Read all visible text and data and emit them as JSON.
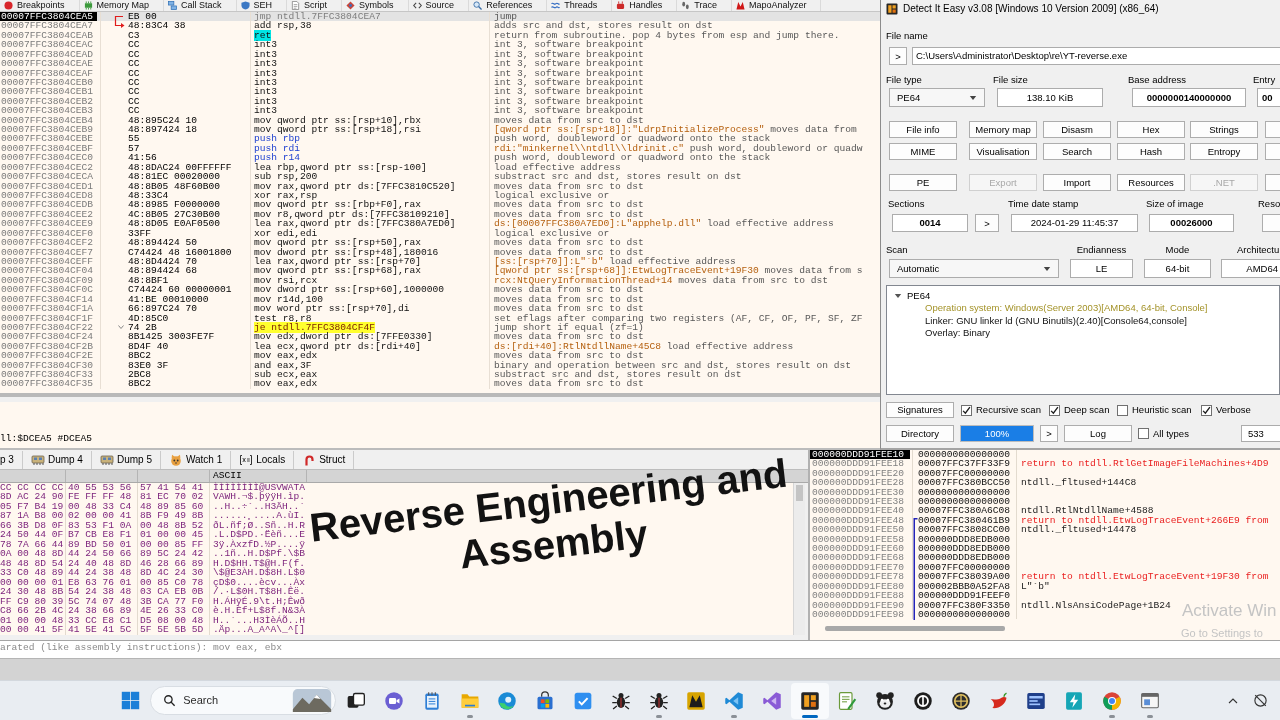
{
  "debugger_tabs": [
    "Breakpoints",
    "Memory Map",
    "Call Stack",
    "SEH",
    "Script",
    "Symbols",
    "Source",
    "References",
    "Threads",
    "Handles",
    "Trace",
    "MapoAnalyzer"
  ],
  "disassembly": {
    "rows": [
      {
        "address": "00007FFC3804CEA5",
        "bytes": "EB 00",
        "instruction": "jmp ntdll.7FFC3804CEA7",
        "comment": "jump",
        "kind": "jump",
        "selected": true
      },
      {
        "address": "00007FFC3804CEA7",
        "bytes": "48:83C4 38",
        "instruction": "add rsp,38",
        "comment": "adds src and dst, stores result on dst",
        "kind": "data",
        "selected": false
      },
      {
        "address": "00007FFC3804CEAB",
        "bytes": "C3",
        "instruction": "ret",
        "comment": "return from subroutine. pop 4 bytes from esp and jump there.",
        "kind": "return",
        "selected": false
      },
      {
        "address": "00007FFC3804CEAC",
        "bytes": "CC",
        "instruction": "int3",
        "comment": "int 3, software breakpoint",
        "kind": "interrupt",
        "selected": false
      },
      {
        "address": "00007FFC3804CEAD",
        "bytes": "CC",
        "instruction": "int3",
        "comment": "int 3, software breakpoint",
        "kind": "interrupt",
        "selected": false
      },
      {
        "address": "00007FFC3804CEAE",
        "bytes": "CC",
        "instruction": "int3",
        "comment": "int 3, software breakpoint",
        "kind": "interrupt",
        "selected": false
      },
      {
        "address": "00007FFC3804CEAF",
        "bytes": "CC",
        "instruction": "int3",
        "comment": "int 3, software breakpoint",
        "kind": "interrupt",
        "selected": false
      },
      {
        "address": "00007FFC3804CEB0",
        "bytes": "CC",
        "instruction": "int3",
        "comment": "int 3, software breakpoint",
        "kind": "interrupt",
        "selected": false
      },
      {
        "address": "00007FFC3804CEB1",
        "bytes": "CC",
        "instruction": "int3",
        "comment": "int 3, software breakpoint",
        "kind": "interrupt",
        "selected": false
      },
      {
        "address": "00007FFC3804CEB2",
        "bytes": "CC",
        "instruction": "int3",
        "comment": "int 3, software breakpoint",
        "kind": "interrupt",
        "selected": false
      },
      {
        "address": "00007FFC3804CEB3",
        "bytes": "CC",
        "instruction": "int3",
        "comment": "int 3, software breakpoint",
        "kind": "interrupt",
        "selected": false
      },
      {
        "address": "00007FFC3804CEB4",
        "bytes": "48:895C24 10",
        "instruction": "mov qword ptr ss:[rsp+10],rbx",
        "comment": "moves data from src to dst",
        "kind": "data",
        "selected": false
      },
      {
        "address": "00007FFC3804CEB9",
        "bytes": "48:897424 18",
        "instruction": "mov qword ptr ss:[rsp+18],rsi",
        "ref": "[qword ptr ss:[rsp+18]]:\"LdrpInitializeProcess\"",
        "comment": "moves data from",
        "kind": "data",
        "selected": false
      },
      {
        "address": "00007FFC3804CEBE",
        "bytes": "55",
        "instruction": "push rbp",
        "comment": "push word, doubleword or quadword onto the stack",
        "kind": "stack",
        "selected": false
      },
      {
        "address": "00007FFC3804CEBF",
        "bytes": "57",
        "instruction": "push rdi",
        "ref": "rdi:\"minkernel\\\\ntdll\\\\ldrinit.c\"",
        "comment": "push word, doubleword or quadw",
        "kind": "stack",
        "selected": false
      },
      {
        "address": "00007FFC3804CEC0",
        "bytes": "41:56",
        "instruction": "push r14",
        "comment": "push word, doubleword or quadword onto the stack",
        "kind": "stack",
        "selected": false
      },
      {
        "address": "00007FFC3804CEC2",
        "bytes": "48:8DAC24 00FFFFFF",
        "instruction": "lea rbp,qword ptr ss:[rsp-100]",
        "comment": "load effective address",
        "kind": "data",
        "selected": false
      },
      {
        "address": "00007FFC3804CECA",
        "bytes": "48:81EC 00020000",
        "instruction": "sub rsp,200",
        "comment": "substract src and dst, stores result on dst",
        "kind": "data",
        "selected": false
      },
      {
        "address": "00007FFC3804CED1",
        "bytes": "48:8B05 48F60B00",
        "instruction": "mov rax,qword ptr ds:[7FFC3810C520]",
        "comment": "moves data from src to dst",
        "kind": "data",
        "selected": false
      },
      {
        "address": "00007FFC3804CED8",
        "bytes": "48:33C4",
        "instruction": "xor rax,rsp",
        "comment": "logical exclusive or",
        "kind": "data",
        "selected": false
      },
      {
        "address": "00007FFC3804CEDB",
        "bytes": "48:8985 F0000000",
        "instruction": "mov qword ptr ss:[rbp+F0],rax",
        "comment": "moves data from src to dst",
        "kind": "data",
        "selected": false
      },
      {
        "address": "00007FFC3804CEE2",
        "bytes": "4C:8B05 27C30B00",
        "instruction": "mov r8,qword ptr ds:[7FFC38109210]",
        "comment": "moves data from src to dst",
        "kind": "data",
        "selected": false
      },
      {
        "address": "00007FFC3804CEE9",
        "bytes": "48:8D05 E0AF0500",
        "instruction": "lea rax,qword ptr ds:[7FFC380A7ED0]",
        "ref": "ds:[00007FFC380A7ED0]:L\"apphelp.dll\"",
        "comment": "load effective address",
        "kind": "data",
        "selected": false
      },
      {
        "address": "00007FFC3804CEF0",
        "bytes": "33FF",
        "instruction": "xor edi,edi",
        "comment": "logical exclusive or",
        "kind": "data",
        "selected": false
      },
      {
        "address": "00007FFC3804CEF2",
        "bytes": "48:894424 50",
        "instruction": "mov qword ptr ss:[rsp+50],rax",
        "comment": "moves data from src to dst",
        "kind": "data",
        "selected": false
      },
      {
        "address": "00007FFC3804CEF7",
        "bytes": "C74424 48 16001800",
        "instruction": "mov dword ptr ss:[rsp+48],180016",
        "comment": "moves data from src to dst",
        "kind": "data",
        "selected": false
      },
      {
        "address": "00007FFC3804CEFF",
        "bytes": "48:8D4424 70",
        "instruction": "lea rax,qword ptr ss:[rsp+70]",
        "ref": "[ss:[rsp+70]]:L\"`b\"",
        "comment": "load effective address",
        "kind": "data",
        "selected": false
      },
      {
        "address": "00007FFC3804CF04",
        "bytes": "48:894424 68",
        "instruction": "mov qword ptr ss:[rsp+68],rax",
        "ref": "[qword ptr ss:[rsp+68]]:EtwLogTraceEvent+19F30",
        "comment": "moves data from s",
        "kind": "data",
        "selected": false
      },
      {
        "address": "00007FFC3804CF09",
        "bytes": "48:8BF1",
        "instruction": "mov rsi,rcx",
        "ref": "rcx:NtQueryInformationThread+14",
        "comment": "moves data from src to dst",
        "kind": "data",
        "selected": false
      },
      {
        "address": "00007FFC3804CF0C",
        "bytes": "C74424 60 00000001",
        "instruction": "mov dword ptr ss:[rsp+60],1000000",
        "comment": "moves data from src to dst",
        "kind": "data",
        "selected": false
      },
      {
        "address": "00007FFC3804CF14",
        "bytes": "41:BE 00010000",
        "instruction": "mov r14d,100",
        "comment": "moves data from src to dst",
        "kind": "data",
        "selected": false
      },
      {
        "address": "00007FFC3804CF1A",
        "bytes": "66:897C24 70",
        "instruction": "mov word ptr ss:[rsp+70],di",
        "comment": "moves data from src to dst",
        "kind": "data",
        "selected": false
      },
      {
        "address": "00007FFC3804CF1F",
        "bytes": "4D:85C0",
        "instruction": "test r8,r8",
        "comment": "set eflags after comparing two registers (AF, CF, OF, PF, SF, ZF",
        "kind": "data",
        "selected": false
      },
      {
        "address": "00007FFC3804CF22",
        "bytes": "74 2B",
        "instruction": "je ntdll.7FFC3804CF4F",
        "comment": "jump short if equal (zf=1)",
        "kind": "branch",
        "selected": false
      },
      {
        "address": "00007FFC3804CF24",
        "bytes": "8B1425 3003FE7F",
        "instruction": "mov edx,dword ptr ds:[7FFE0330]",
        "comment": "moves data from src to dst",
        "kind": "data",
        "selected": false
      },
      {
        "address": "00007FFC3804CF2B",
        "bytes": "8D4F 40",
        "instruction": "lea ecx,qword ptr ds:[rdi+40]",
        "ref": "ds:[rdi+40]:RtlNtdllName+45C8",
        "comment": "load effective address",
        "kind": "data",
        "selected": false
      },
      {
        "address": "00007FFC3804CF2E",
        "bytes": "8BC2",
        "instruction": "mov eax,edx",
        "comment": "moves data from src to dst",
        "kind": "data",
        "selected": false
      },
      {
        "address": "00007FFC3804CF30",
        "bytes": "83E0 3F",
        "instruction": "and eax,3F",
        "comment": "binary and operation between src and dst, stores result on dst",
        "kind": "data",
        "selected": false
      },
      {
        "address": "00007FFC3804CF33",
        "bytes": "2BC8",
        "instruction": "sub ecx,eax",
        "comment": "substract src and dst, stores result on dst",
        "kind": "data",
        "selected": false
      },
      {
        "address": "00007FFC3804CF35",
        "bytes": "8BC2",
        "instruction": "mov eax,edx",
        "comment": "moves data from src to dst",
        "kind": "data",
        "selected": false
      }
    ]
  },
  "info_line": "ll:$DCEA5 #DCEA5",
  "dump": {
    "tabs": [
      "p 3",
      "Dump 4",
      "Dump 5",
      "Watch 1",
      "Locals",
      "Struct"
    ],
    "ascii_header": "ASCII",
    "rows": [
      {
        "hex": [
          "CC CC CC CC",
          "40 55 53 56",
          "57 41 54 41"
        ],
        "ascii": "ÌÌÌÌÌÌÌÌ@USVWATA"
      },
      {
        "hex": [
          "8D AC 24 90",
          "FE FF FF 48",
          "81 EC 70 02"
        ],
        "ascii": "VAWH.¬$.þÿÿH.ìp."
      },
      {
        "hex": [
          "05 F7 B4 19",
          "00 48 33 C4",
          "48 89 85 60"
        ],
        "ascii": "..H..÷´..H3ÄH..`"
      },
      {
        "hex": [
          "87 1A B8 00",
          "02 00 00 41",
          "8B F9 49 8B"
        ],
        "ascii": "......¸....A.ùI."
      },
      {
        "hex": [
          "66 3B D8 0F",
          "83 53 F1 0A",
          "00 48 8B 52"
        ],
        "ascii": "ðL.ñf;Ø..Sñ..H.R"
      },
      {
        "hex": [
          "24 50 44 0F",
          "B7 CB E8 F1",
          "01 00 00 45"
        ],
        "ascii": ".L.D$PD.·Ëèñ...E"
      },
      {
        "hex": [
          "78 7A 66 44",
          "89 BD 50 01",
          "00 00 85 FF"
        ],
        "ascii": "3ÿ.ÀxzfD.½P....ÿ"
      },
      {
        "hex": [
          "0A 00 48 8D",
          "44 24 50 66",
          "89 5C 24 42"
        ],
        "ascii": "..1ñ..H.D$Pf.\\$B"
      },
      {
        "hex": [
          "48 48 8D 54",
          "24 40 48 8D",
          "46 28 66 89"
        ],
        "ascii": "H.D$HH.T$@H.F(f."
      },
      {
        "hex": [
          "33 C0 48 89",
          "44 24 38 48",
          "8D 4C 24 30"
        ],
        "ascii": "\\$@E3ÀH.D$8H.L$0"
      },
      {
        "hex": [
          "00 00 00 01",
          "E8 63 76 01",
          "00 85 C0 78"
        ],
        "ascii": "çD$0....ècv...Àx"
      },
      {
        "hex": [
          "24 30 48 8B",
          "54 24 38 48",
          "03 CA EB 0B"
        ],
        "ascii": "/.·L$0H.T$8H.Êë."
      },
      {
        "hex": [
          "FF C9 80 39",
          "5C 74 07 48",
          "3B CA 77 F0"
        ],
        "ascii": "H.ÁHÿÉ.9\\t.H;Êwð"
      },
      {
        "hex": [
          "C8 66 2B 4C",
          "24 38 66 89",
          "4E 26 33 C0"
        ],
        "ascii": "è.H.Èf+L$8f.N&3À"
      },
      {
        "hex": [
          "01 00 00 48",
          "33 CC E8 C1",
          "D5 08 00 48"
        ],
        "ascii": "H..`...H3ÌèÁÕ..H"
      },
      {
        "hex": [
          "00 00 41 5F",
          "41 5E 41 5C",
          "5F 5E 5B 5D"
        ],
        "ascii": ".Äp...A_A^A\\_^[]"
      }
    ]
  },
  "stack": {
    "rows": [
      {
        "address": "000000DDD91FEE10",
        "value": "0000000000000000",
        "selected": true
      },
      {
        "address": "000000DDD91FEE18",
        "value": "00007FFC37FF33F9",
        "comment": {
          "text": "return to ntdll.RtlGetImageFileMachines+4D9",
          "kind": "return"
        },
        "selected": false
      },
      {
        "address": "000000DDD91FEE20",
        "value": "00007FFC00000000",
        "selected": false
      },
      {
        "address": "000000DDD91FEE28",
        "value": "00007FFC380BCC50",
        "comment": {
          "text": "ntdll._fltused+144C8",
          "kind": "symbol"
        },
        "selected": false
      },
      {
        "address": "000000DDD91FEE30",
        "value": "0000000000000000",
        "selected": false
      },
      {
        "address": "000000DDD91FEE38",
        "value": "0000000000000000",
        "selected": false
      },
      {
        "address": "000000DDD91FEE40",
        "value": "00007FFC380A6C08",
        "comment": {
          "text": "ntdll.RtlNtdllName+4588",
          "kind": "symbol"
        },
        "selected": false
      },
      {
        "address": "000000DDD91FEE48",
        "value": "00007FFC380461B9",
        "comment": {
          "text": "return to ntdll.EtwLogTraceEvent+266E9 from",
          "kind": "return"
        },
        "selected": false
      },
      {
        "address": "000000DDD91FEE50",
        "value": "00007FFC3808CC00",
        "comment": {
          "text": "ntdll._fltused+14478",
          "kind": "symbol"
        },
        "selected": false
      },
      {
        "address": "000000DDD91FEE58",
        "value": "000000DDD8EDB000",
        "selected": false
      },
      {
        "address": "000000DDD91FEE60",
        "value": "000000DDD8EDB000",
        "selected": false
      },
      {
        "address": "000000DDD91FEE68",
        "value": "000000DDD8EDB000",
        "selected": false
      },
      {
        "address": "000000DDD91FEE70",
        "value": "00007FFC00000000",
        "selected": false
      },
      {
        "address": "000000DDD91FEE78",
        "value": "00007FFC38039A00",
        "comment": {
          "text": "return to ntdll.EtwLogTraceEvent+19F30 from",
          "kind": "return"
        },
        "selected": false
      },
      {
        "address": "000000DDD91FEE80",
        "value": "000002BBB0A52FA8",
        "comment": {
          "text": "L\"`b\"",
          "kind": "symbol"
        },
        "selected": false
      },
      {
        "address": "000000DDD91FEE88",
        "value": "000000DDD91FEEF0",
        "selected": false
      },
      {
        "address": "000000DDD91FEE90",
        "value": "00007FFC380F3350",
        "comment": {
          "text": "ntdll.NlsAnsiCodePage+1B24",
          "kind": "symbol"
        },
        "selected": false
      },
      {
        "address": "000000DDD91FEE98",
        "value": "0000000000000000",
        "selected": false
      }
    ]
  },
  "command": {
    "placeholder": "arated (like assembly instructions): mov eax, ebx"
  },
  "die": {
    "title": "Detect It Easy v3.08 [Windows 10 Version 2009] (x86_64)",
    "file_name_label": "File name",
    "browse_button": ">",
    "file_path": "C:\\Users\\Administrator\\Desktop\\re\\YT-reverse.exe",
    "info_fields": [
      {
        "label": "File type",
        "value": "PE64",
        "kind": "combo"
      },
      {
        "label": "File size",
        "value": "138.10 KiB",
        "kind": "text"
      },
      {
        "label": "Base address",
        "value": "0000000140000000",
        "kind": "number"
      },
      {
        "label": "Entry",
        "value": "00",
        "kind": "number"
      }
    ],
    "tool_buttons": [
      [
        {
          "label": "File info",
          "disabled": false
        },
        {
          "label": "Memory map",
          "disabled": false
        },
        {
          "label": "Disasm",
          "disabled": false
        },
        {
          "label": "Hex",
          "disabled": false
        },
        {
          "label": "Strings",
          "disabled": false
        }
      ],
      [
        {
          "label": "MIME",
          "disabled": false
        },
        {
          "label": "Visualisation",
          "disabled": false
        },
        {
          "label": "Search",
          "disabled": false
        },
        {
          "label": "Hash",
          "disabled": false
        },
        {
          "label": "Entropy",
          "disabled": false
        }
      ],
      [
        {
          "label": "PE",
          "disabled": false
        },
        {
          "label": "Export",
          "disabled": true
        },
        {
          "label": "Import",
          "disabled": false
        },
        {
          "label": "Resources",
          "disabled": false
        },
        {
          "label": ".NET",
          "disabled": true
        }
      ]
    ],
    "pe_fields": [
      {
        "label": "Sections",
        "value": "0014",
        "kind": "number",
        "button": ">"
      },
      {
        "label": "Time date stamp",
        "value": "2024-01-29 11:45:37",
        "kind": "text"
      },
      {
        "label": "Size of image",
        "value": "00026000",
        "kind": "number"
      },
      {
        "label": "Reso",
        "kind": "cut"
      }
    ],
    "scan_fields": [
      {
        "label": "Scan",
        "value": "Automatic",
        "kind": "combo"
      },
      {
        "label": "Endianness",
        "value": "LE",
        "kind": "text"
      },
      {
        "label": "Mode",
        "value": "64-bit",
        "kind": "text"
      },
      {
        "label": "Architectu",
        "value": "AMD64",
        "kind": "text"
      }
    ],
    "results": {
      "label": "PE64",
      "expanded": true,
      "children": [
        {
          "text": "Operation system: Windows(Server 2003)[AMD64, 64-bit, Console]",
          "kind": "os"
        },
        {
          "text": "Linker: GNU linker ld (GNU Binutils)(2.40)[Console64,console]",
          "kind": "tool"
        },
        {
          "text": "Overlay: Binary",
          "kind": "tool"
        }
      ]
    },
    "signatures_button": "Signatures",
    "scan_options": [
      {
        "label": "Recursive scan",
        "checked": true
      },
      {
        "label": "Deep scan",
        "checked": true
      },
      {
        "label": "Heuristic scan",
        "checked": false
      },
      {
        "label": "Verbose",
        "checked": true
      }
    ],
    "directory_button": "Directory",
    "progress": {
      "level": 1,
      "reading": "100%"
    },
    "next_button": ">",
    "log_button": "Log",
    "all_types": {
      "label": "All types",
      "checked": false
    },
    "count": "533"
  },
  "overlay_title": "Reverse Engineering and Assembly",
  "activation_notice": [
    "Activate Win",
    "Go to Settings to"
  ],
  "taskbar": {
    "search": {
      "placeholder": "Search"
    },
    "apps": [
      {
        "running": false,
        "selected": false
      },
      {
        "running": false,
        "selected": false
      },
      {
        "running": false,
        "selected": false
      },
      {
        "running": true,
        "selected": false
      },
      {
        "running": false,
        "selected": false
      },
      {
        "running": false,
        "selected": false
      },
      {
        "running": false,
        "selected": false
      },
      {
        "running": false,
        "selected": false
      },
      {
        "running": true,
        "selected": false
      },
      {
        "running": false,
        "selected": false
      },
      {
        "running": true,
        "selected": false
      },
      {
        "running": false,
        "selected": false
      },
      {
        "running": true,
        "selected": true
      },
      {
        "running": false,
        "selected": false
      },
      {
        "running": false,
        "selected": false
      },
      {
        "running": false,
        "selected": false
      },
      {
        "running": false,
        "selected": false
      },
      {
        "running": false,
        "selected": false
      },
      {
        "running": false,
        "selected": false
      },
      {
        "running": false,
        "selected": false
      },
      {
        "running": true,
        "selected": false
      },
      {
        "running": true,
        "selected": false
      }
    ]
  }
}
